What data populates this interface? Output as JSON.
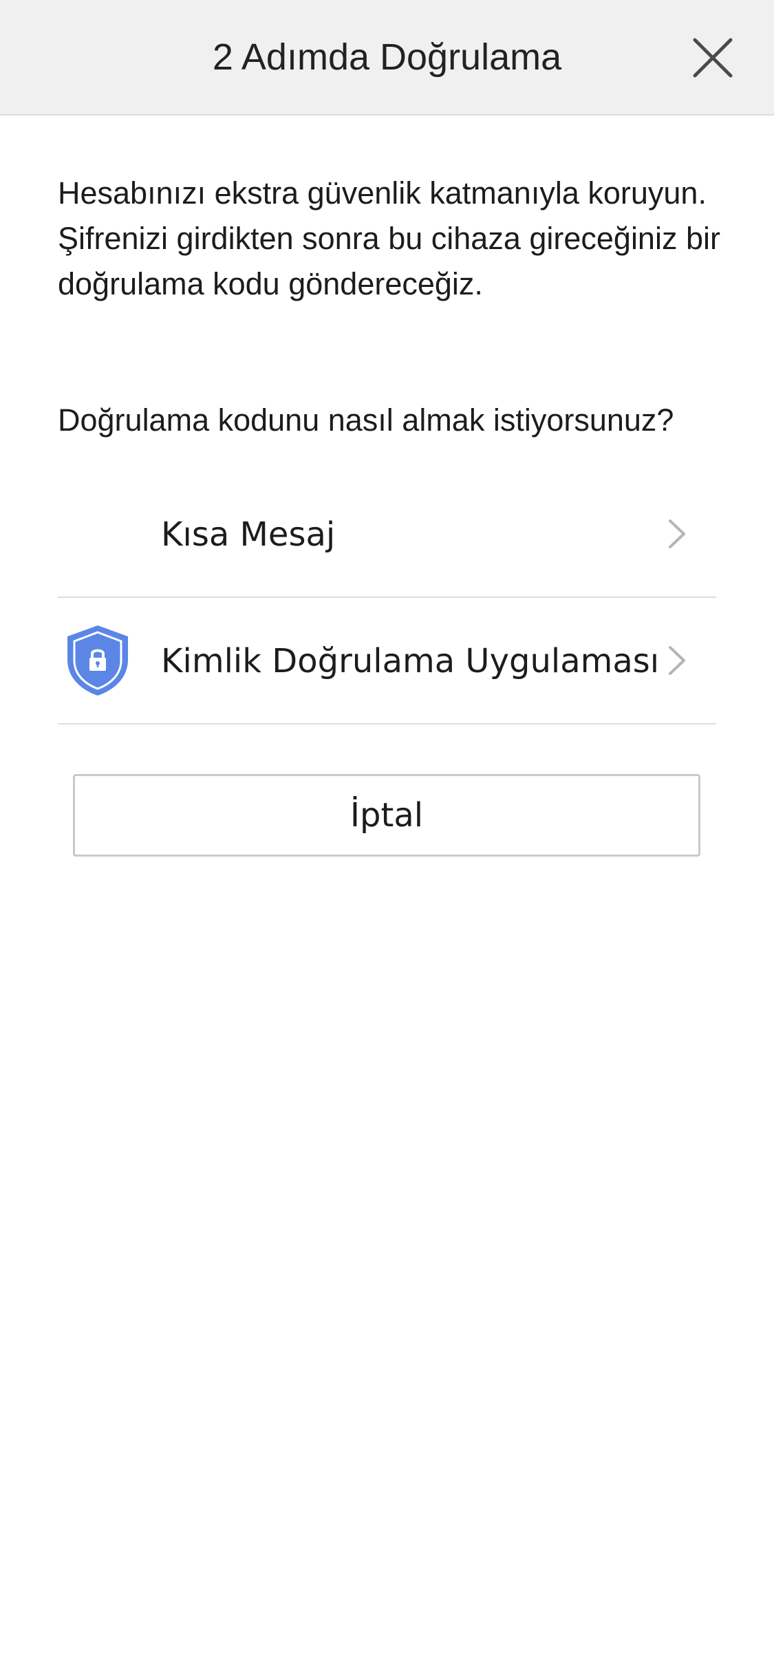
{
  "header": {
    "title": "2 Adımda Doğrulama",
    "close_icon": "close-icon"
  },
  "intro": {
    "text": "Hesabınızı ekstra güvenlik katmanıyla koruyun. Şifrenizi girdikten sonra bu cihaza gireceğiniz bir doğrulama kodu göndereceğiz."
  },
  "question": {
    "text": "Doğrulama kodunu nasıl almak istiyorsunuz?"
  },
  "options": [
    {
      "label": "Kısa Mesaj",
      "icon": "",
      "chevron_icon": "chevron-right-icon"
    },
    {
      "label": "Kimlik Doğrulama Uygulaması",
      "icon": "shield-lock-icon",
      "chevron_icon": "chevron-right-icon"
    }
  ],
  "cancel": {
    "label": "İptal"
  },
  "colors": {
    "header_bg": "#f0f0f0",
    "shield_blue": "#5b86e5",
    "divider": "#dedede",
    "chevron": "#b5b5b5"
  }
}
